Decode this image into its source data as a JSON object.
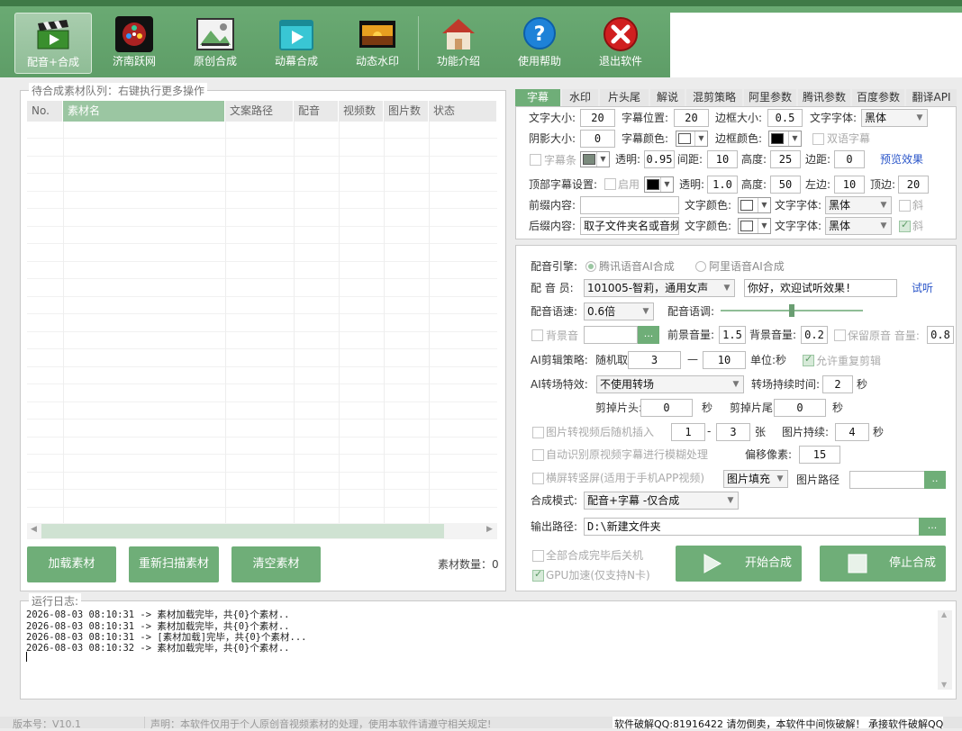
{
  "toolbar": {
    "buttons": [
      {
        "label": "配音+合成",
        "icon": "clapperboard-icon"
      },
      {
        "label": "济南跃网",
        "icon": "film-reel-icon"
      },
      {
        "label": "原创合成",
        "icon": "image-edit-icon"
      },
      {
        "label": "动幕合成",
        "icon": "video-play-icon"
      },
      {
        "label": "动态水印",
        "icon": "sunset-photo-icon"
      },
      {
        "label": "功能介绍",
        "icon": "home-icon"
      },
      {
        "label": "使用帮助",
        "icon": "help-icon"
      },
      {
        "label": "退出软件",
        "icon": "exit-icon"
      }
    ]
  },
  "queue": {
    "legend": "待合成素材队列：右键执行更多操作",
    "columns": [
      "No.",
      "素材名",
      "文案路径",
      "配音",
      "视频数",
      "图片数",
      "状态"
    ],
    "buttons": {
      "load": "加载素材",
      "rescan": "重新扫描素材",
      "clear": "清空素材"
    },
    "count_label": "素材数量：0"
  },
  "tabs": [
    "字幕",
    "水印",
    "片头尾",
    "解说",
    "混剪策略",
    "阿里参数",
    "腾讯参数",
    "百度参数",
    "翻译API"
  ],
  "subtitle": {
    "font_size_label": "文字大小:",
    "font_size": "20",
    "position_label": "字幕位置:",
    "position": "20",
    "border_size_label": "边框大小:",
    "border_size": "0.5",
    "font_label": "文字字体:",
    "font": "黑体",
    "shadow_label": "阴影大小:",
    "shadow": "0",
    "color_label": "字幕颜色:",
    "border_color_label": "边框颜色:",
    "bilingual_label": "双语字幕",
    "bar_label": "字幕条",
    "opacity_label": "透明:",
    "opacity": "0.95",
    "spacing_label": "间距:",
    "spacing": "10",
    "height_label": "高度:",
    "height": "25",
    "margin_label": "边距:",
    "margin": "0",
    "preview_label": "预览效果",
    "top_label": "顶部字幕设置:",
    "top_enable_label": "启用",
    "top_opacity_label": "透明:",
    "top_opacity": "1.0",
    "top_height_label": "高度:",
    "top_height": "50",
    "top_left_label": "左边:",
    "top_left": "10",
    "top_top_label": "顶边:",
    "top_top": "20",
    "prefix_label": "前缀内容:",
    "prefix": "",
    "prefix_color_label": "文字颜色:",
    "prefix_font_label": "文字字体:",
    "prefix_font": "黑体",
    "italic_label": "斜",
    "suffix_label": "后缀内容:",
    "suffix": "取子文件夹名或音频",
    "suffix_color_label": "文字颜色:",
    "suffix_font_label": "文字字体:",
    "suffix_font": "黑体",
    "suffix_italic_label": "斜"
  },
  "dubbing": {
    "engine_label": "配音引擎:",
    "engine_tencent": "腾讯语音AI合成",
    "engine_ali": "阿里语音AI合成",
    "voice_label": "配 音 员:",
    "voice": "101005-智莉，通用女声",
    "test_text": "你好，欢迎试听效果!",
    "listen_label": "试听",
    "speed_label": "配音语速:",
    "speed": "0.6倍",
    "tone_label": "配音语调:",
    "tone_level": 0.5,
    "bgm_label": "背景音",
    "fg_volume_label": "前景音量:",
    "fg_volume": "1.5",
    "bg_volume_label": "背景音量:",
    "bg_volume": "0.2",
    "keep_original_label": "保留原音 音量:",
    "keep_original_volume": "0.8",
    "ai_strategy_label": "AI剪辑策略:",
    "random_label": "随机取:",
    "random_from": "3",
    "random_dash": "—",
    "random_to": "10",
    "unit_label": "单位:秒",
    "allow_repeat_label": "允许重复剪辑",
    "transition_label": "AI转场特效:",
    "transition": "不使用转场",
    "transition_duration_label": "转场持续时间:",
    "transition_duration": "2",
    "sec1": "秒",
    "cut_head_label": "剪掉片头:",
    "cut_head": "0",
    "sec2": "秒",
    "cut_tail_label": "剪掉片尾:",
    "cut_tail": "0",
    "sec3": "秒",
    "img_insert_label": "图片转视频后随机插入",
    "img_from": "1",
    "img_dash": "-",
    "img_to": "3",
    "img_unit": "张",
    "img_duration_label": "图片持续:",
    "img_duration": "4",
    "sec4": "秒",
    "auto_blur_label": "自动识别原视频字幕进行模糊处理",
    "offset_label": "偏移像素:",
    "offset": "15",
    "landscape_label": "横屏转竖屏(适用于手机APP视频)",
    "fill_mode": "图片填充",
    "img_path_label": "图片路径",
    "mode_label": "合成模式:",
    "mode": "配音+字幕 -仅合成",
    "output_label": "输出路径:",
    "output": "D:\\新建文件夹",
    "shutdown_label": "全部合成完毕后关机",
    "gpu_label": "GPU加速(仅支持N卡)",
    "start_label": "开始合成",
    "stop_label": "停止合成"
  },
  "log": {
    "legend": "运行日志:",
    "lines": [
      "2026-08-03 08:10:31 -> 素材加载完毕，共{0}个素材..",
      "2026-08-03 08:10:31 -> 素材加载完毕，共{0}个素材..",
      "2026-08-03 08:10:31 -> [素材加载]完毕，共{0}个素材...",
      "2026-08-03 08:10:32 -> 素材加载完毕，共{0}个素材.."
    ]
  },
  "status": {
    "version": "版本号：V10.1",
    "notice": "声明：本软件仅用于个人原创音视频素材的处理，使用本软件请遵守相关规定!",
    "promo": "软件破解QQ:81916422 请勿倒卖，本软件中间恢破解！ 承接软件破解QQ"
  },
  "colors": {
    "accent": "#6fae78",
    "toolbar": "#6bab74",
    "header_selected": "#9bc6a2"
  }
}
